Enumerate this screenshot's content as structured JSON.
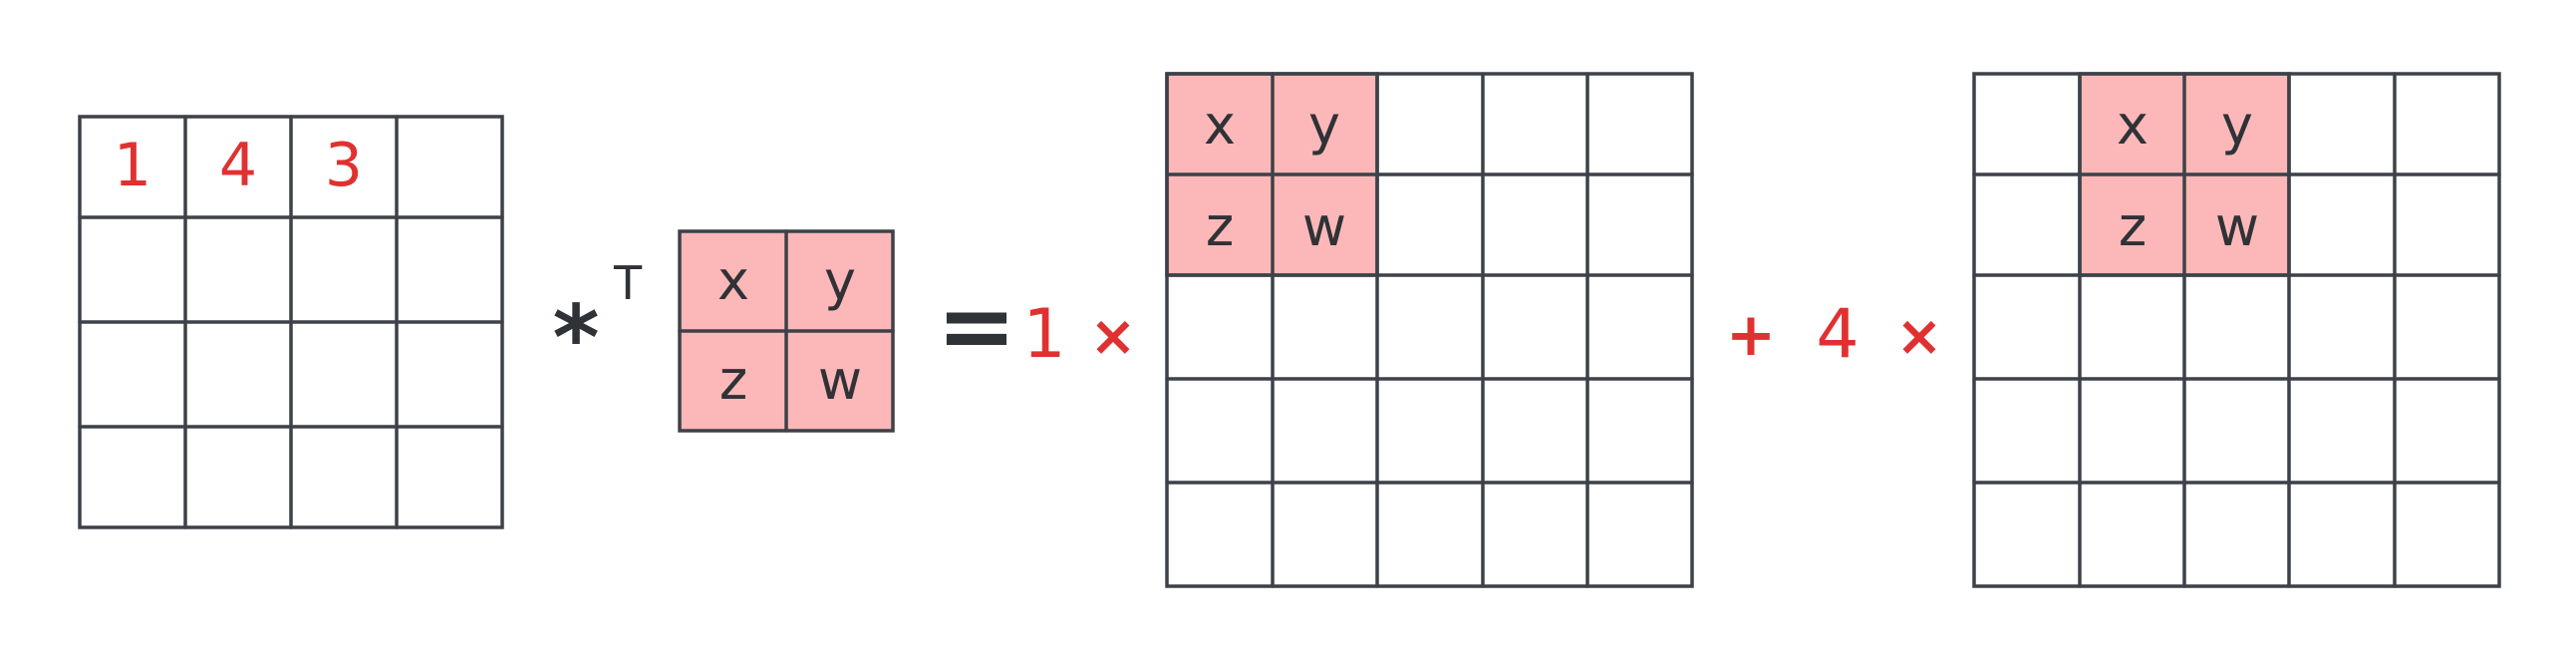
{
  "input_grid": {
    "rows": 4,
    "cols": 4,
    "first_row_values": [
      "1",
      "4",
      "3",
      ""
    ]
  },
  "operator": {
    "symbol": "*",
    "superscript": "T"
  },
  "kernel": {
    "cells": [
      "x",
      "y",
      "z",
      "w"
    ]
  },
  "equals": "=",
  "terms": [
    {
      "coefficient": "1",
      "times": "×",
      "kernel_offset_col": 0
    },
    {
      "plus": "+",
      "coefficient": "4",
      "times": "×",
      "kernel_offset_col": 1
    }
  ],
  "output_grid": {
    "rows": 5,
    "cols": 5
  },
  "colors": {
    "line": "#3d4148",
    "kernel_fill": "#fcb8b8",
    "red": "#e03131",
    "dark": "#2f3237"
  }
}
